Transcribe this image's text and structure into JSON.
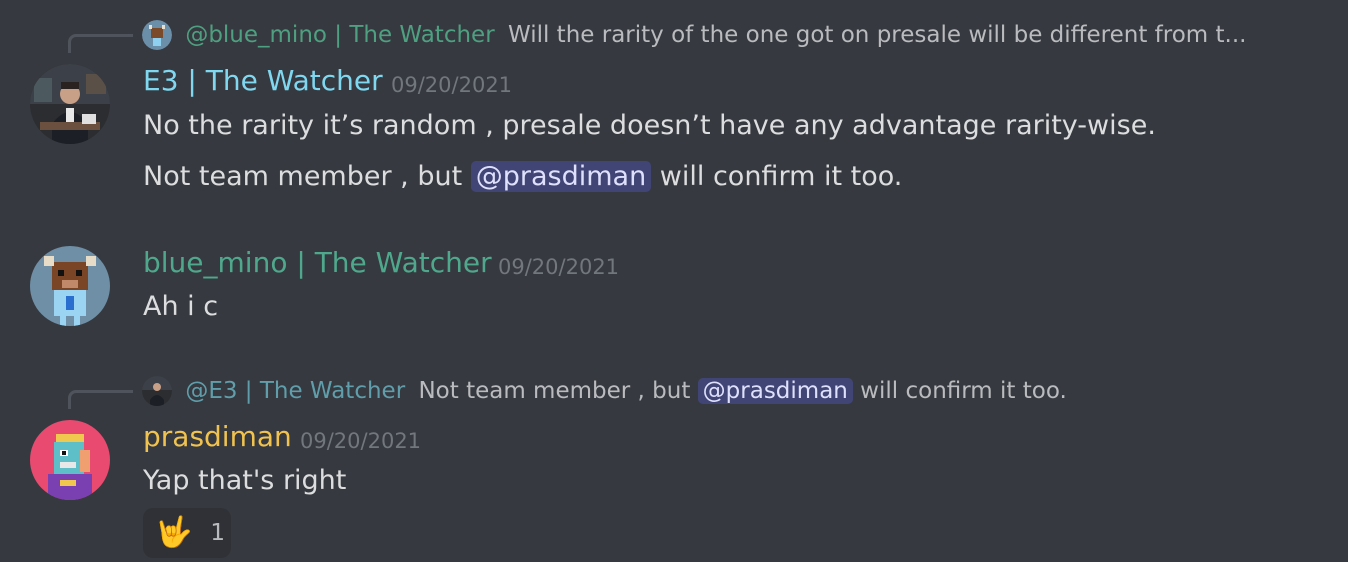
{
  "messages": [
    {
      "reply": {
        "author": "@blue_mino | The Watcher",
        "text": "Will the rarity of the one got on presale will be different from t..."
      },
      "author": "E3 | The Watcher",
      "author_color": "#7fd8f0",
      "timestamp": "09/20/2021",
      "lines": [
        "No the rarity it’s random , presale doesn’t have any advantage rarity-wise.",
        {
          "before": "Not team member , but ",
          "mention": "@prasdiman",
          "after": " will confirm it too."
        }
      ]
    },
    {
      "author": "blue_mino | The Watcher",
      "author_color": "#4fa88c",
      "timestamp": "09/20/2021",
      "lines": [
        "Ah i c"
      ]
    },
    {
      "reply": {
        "author": "@E3 | The Watcher",
        "before": "Not team member , but ",
        "mention": "@prasdiman",
        "after": " will confirm it too."
      },
      "author": "prasdiman",
      "author_color": "#f0c350",
      "timestamp": "09/20/2021",
      "lines": [
        "Yap that's right"
      ],
      "reaction": {
        "emoji": "🤟",
        "count": "1"
      }
    }
  ],
  "colors": {
    "background": "#36393f",
    "text": "#dcddde",
    "timestamp": "#72767d",
    "mention_bg": "#4a4f8a",
    "reaction_bg": "#2f3136"
  }
}
